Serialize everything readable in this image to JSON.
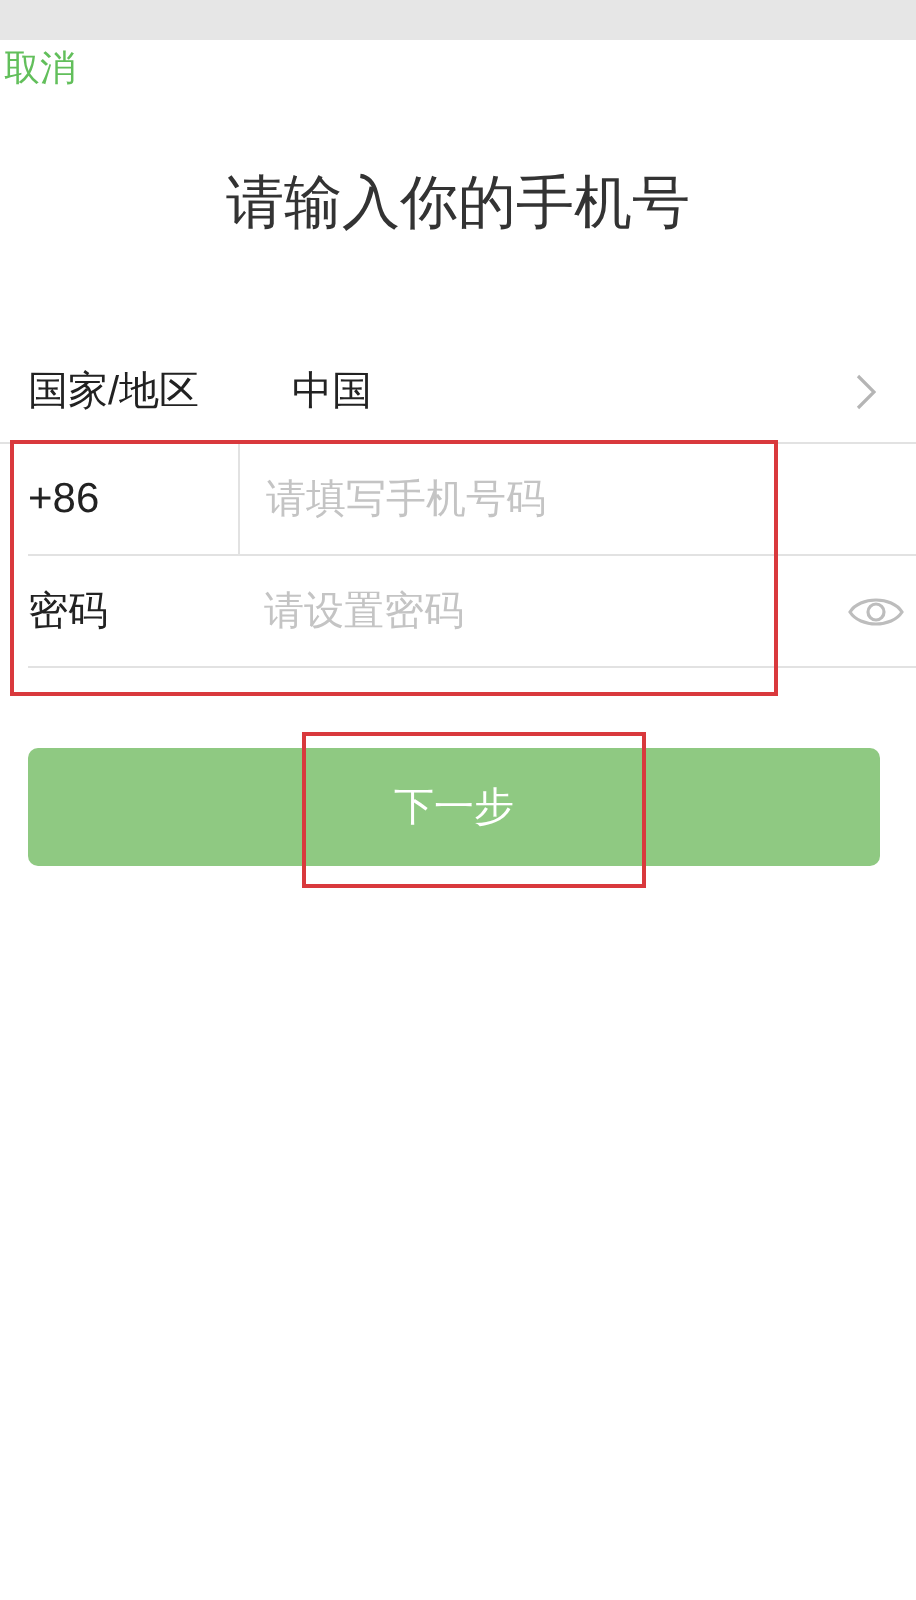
{
  "nav": {
    "cancel": "取消"
  },
  "title": "请输入你的手机号",
  "form": {
    "region_label": "国家/地区",
    "region_value": "中国",
    "country_code": "+86",
    "phone_placeholder": "请填写手机号码",
    "password_label": "密码",
    "password_placeholder": "请设置密码"
  },
  "next_button": {
    "label": "下一步",
    "disabled": true
  }
}
